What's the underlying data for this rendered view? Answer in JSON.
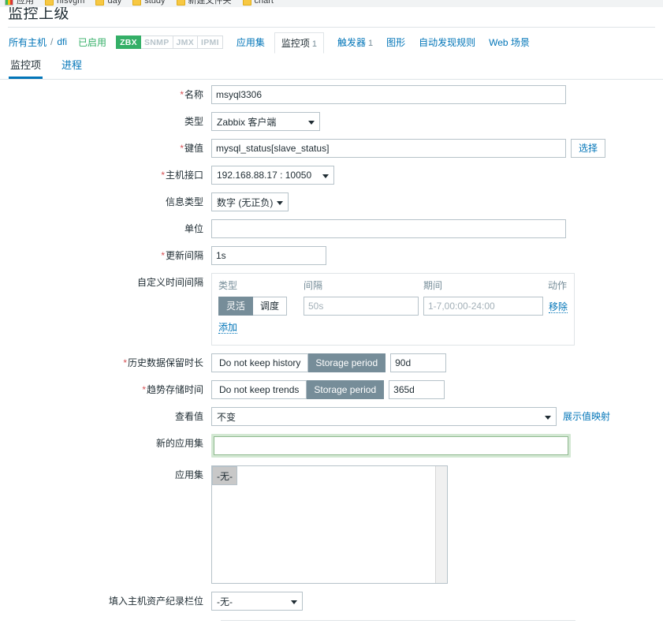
{
  "browser": {
    "bookmarks": [
      {
        "label": "应用",
        "icon": "chrome-apps-icon"
      },
      {
        "label": "nfsvgm",
        "icon": "folder-icon"
      },
      {
        "label": "day",
        "icon": "folder-icon"
      },
      {
        "label": "study",
        "icon": "folder-icon"
      },
      {
        "label": "新建文件夹",
        "icon": "folder-icon"
      },
      {
        "label": "chart",
        "icon": "folder-icon"
      }
    ]
  },
  "page": {
    "title": "监控上级"
  },
  "objectnav": {
    "all_hosts": "所有主机",
    "separator": "/",
    "host": "dfi",
    "status": "已启用",
    "protocols": [
      {
        "name": "ZBX",
        "active": true
      },
      {
        "name": "SNMP",
        "active": false
      },
      {
        "name": "JMX",
        "active": false
      },
      {
        "name": "IPMI",
        "active": false
      }
    ],
    "links": [
      {
        "label": "应用集",
        "count": "",
        "selected": false
      },
      {
        "label": "监控项",
        "count": "1",
        "selected": true
      },
      {
        "label": "触发器",
        "count": "1",
        "selected": false
      },
      {
        "label": "图形",
        "count": "",
        "selected": false
      },
      {
        "label": "自动发现规则",
        "count": "",
        "selected": false
      },
      {
        "label": "Web 场景",
        "count": "",
        "selected": false
      }
    ]
  },
  "subtabs": [
    {
      "label": "监控项",
      "active": true
    },
    {
      "label": "进程",
      "active": false
    }
  ],
  "form": {
    "name": {
      "label": "名称",
      "required": true,
      "value": "msyql3306"
    },
    "type": {
      "label": "类型",
      "required": false,
      "value": "Zabbix 客户端"
    },
    "key": {
      "label": "键值",
      "required": true,
      "value": "mysql_status[slave_status]",
      "select_button": "选择"
    },
    "host_interface": {
      "label": "主机接口",
      "required": true,
      "value": "192.168.88.17 : 10050"
    },
    "value_type": {
      "label": "信息类型",
      "required": false,
      "value": "数字 (无正负)"
    },
    "units": {
      "label": "单位",
      "required": false,
      "value": ""
    },
    "update_interval": {
      "label": "更新间隔",
      "required": true,
      "value": "1s"
    },
    "custom_intervals": {
      "label": "自定义时间间隔",
      "headers": {
        "type": "类型",
        "interval": "间隔",
        "period": "期间",
        "action": "动作"
      },
      "rows": [
        {
          "type_options": [
            {
              "label": "灵活",
              "active": true
            },
            {
              "label": "调度",
              "active": false
            }
          ],
          "interval_value": "",
          "interval_placeholder": "50s",
          "period_value": "",
          "period_placeholder": "1-7,00:00-24:00",
          "remove_label": "移除"
        }
      ],
      "add_label": "添加"
    },
    "history": {
      "label": "历史数据保留时长",
      "required": true,
      "options": [
        {
          "label": "Do not keep history",
          "active": false
        },
        {
          "label": "Storage period",
          "active": true
        }
      ],
      "value": "90d"
    },
    "trends": {
      "label": "趋势存储时间",
      "required": true,
      "options": [
        {
          "label": "Do not keep trends",
          "active": false
        },
        {
          "label": "Storage period",
          "active": true
        }
      ],
      "value": "365d"
    },
    "show_value": {
      "label": "查看值",
      "required": false,
      "value": "不变",
      "link": "展示值映射"
    },
    "new_application": {
      "label": "新的应用集",
      "required": false,
      "value": "",
      "focused": true
    },
    "applications": {
      "label": "应用集",
      "required": false,
      "options": [
        {
          "label": "-无-",
          "selected": true
        }
      ]
    },
    "inventory_field": {
      "label": "填入主机资产纪录栏位",
      "required": false,
      "value": "-无-"
    }
  },
  "colors": {
    "accent": "#0275b8",
    "green": "#34af67",
    "required": "#d65256",
    "toggle_on": "#768d99",
    "focus_ring": "#d3e8d3"
  }
}
